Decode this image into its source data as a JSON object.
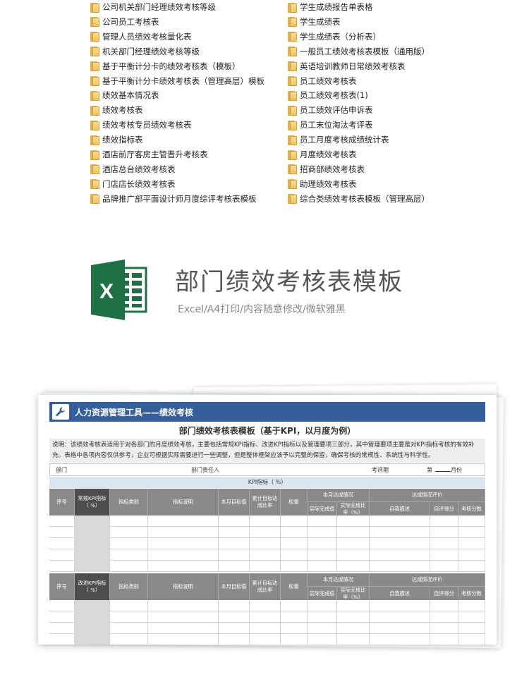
{
  "file_list": {
    "left": [
      "公司机关部门经理绩效考核等级",
      "公司员工考核表",
      "管理人员绩效考核量化表",
      "机关部门经理绩效考核等级",
      "基于平衡计分卡的绩效考核表（模板）",
      "基于平衡计分卡绩效考核表（管理高层）模板",
      "绩效基本情况表",
      "绩效考核表",
      "绩效考核专员绩效考核表",
      "绩效指标表",
      "酒店前厅客房主管晋升考核表",
      "酒店总台绩效考核表",
      "门店店长绩效考核表",
      "品牌推广部平面设计师月度综评考核表模板"
    ],
    "right": [
      "学生成绩报告单表格",
      "学生成绩表",
      "学生成绩表（分析表）",
      "一般员工绩效考核表模板（通用版）",
      "英语培训教师日常绩效考核表",
      "员工绩效考核表",
      "员工绩效考核表(1)",
      "员工绩效评估申诉表",
      "员工末位淘汰考评表",
      "员工月度考核成绩统计表",
      "月度绩效考核表",
      "招商部绩效考核表",
      "助理绩效考核表",
      "综合类绩效考核表模板（管理高层）"
    ]
  },
  "hero": {
    "title": "部门绩效考核表模板",
    "subtitle": "Excel/A4打印/内容随意修改/微软雅黑",
    "logo_letter": "X",
    "logo_color": "#1e7145"
  },
  "sheet": {
    "header": "人力资源管理工具——绩效考核",
    "title": "部门绩效考核表模板（基于KPI，以月度为例）",
    "description": "说明：该绩效考核表适用于对各部门的月度绩效考核，主要包括常规KPI指标、改进KPI指标以及管理要项三部分，其中管理要项主要是对KPI指标考核的有效补充。表格中各项内容仅供参考，企业可根据实际需要进行一些调整，但是整体框架应该予以完整的保留，确保考核的常规性、系统性与科学性。",
    "meta": {
      "dept": "部门",
      "dept_head": "部门责任人",
      "review_period": "考评期",
      "month_prefix": "第",
      "month_suffix": "月份"
    },
    "kpi_band": "KPI指标（      %）",
    "table1": {
      "col_index": "序号",
      "col_kpi": "常规KPI指标\n（  %）",
      "col_category": "指标类别",
      "col_desc": "指标说明",
      "col_target": "本月目标值",
      "col_cum_rate": "累计目标达成比率",
      "col_weight": "权重",
      "group_month": "本月达成情况",
      "col_actual": "实际完成值",
      "col_actual_rate": "实际完成比率（%）",
      "group_eval": "达成情况评价",
      "col_self_desc": "自我描述",
      "col_self_score": "自评得分",
      "col_score": "考核分数"
    },
    "table2": {
      "col_index": "序号",
      "col_kpi": "改进KPI指标\n（  %）",
      "col_category": "指标类别",
      "col_desc": "指标说明",
      "col_target": "本月目标值",
      "col_cum_rate": "累计目标达成比率",
      "col_weight": "权重",
      "group_month": "本月达成情况",
      "col_actual": "实际完成值",
      "col_actual_rate": "实际完成比率（%）",
      "group_eval": "达成情况评价",
      "col_self_desc": "自我描述",
      "col_self_score": "自评得分",
      "col_score": "考核分数"
    },
    "colors": {
      "header_blue": "#345f9a",
      "table_head_gray": "#8a8a8a",
      "table_head_dark": "#4d4d4d",
      "kpi_band": "#dbe7f0"
    }
  }
}
